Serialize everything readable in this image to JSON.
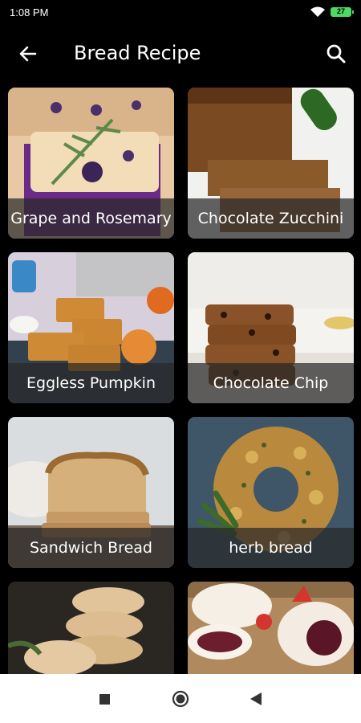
{
  "status": {
    "time": "1:08 PM",
    "battery": "27"
  },
  "appbar": {
    "title": "Bread Recipe"
  },
  "recipes": [
    {
      "name": "Grape and Rosemary"
    },
    {
      "name": "Chocolate Zucchini"
    },
    {
      "name": "Eggless Pumpkin"
    },
    {
      "name": "Chocolate Chip"
    },
    {
      "name": "Sandwich Bread"
    },
    {
      "name": "herb bread"
    },
    {
      "name": ""
    },
    {
      "name": ""
    }
  ],
  "icons": {
    "back": "arrow-left-icon",
    "search": "search-icon",
    "wifi": "wifi-icon",
    "nav_recent": "square-icon",
    "nav_home": "circle-icon",
    "nav_back": "triangle-back-icon"
  }
}
